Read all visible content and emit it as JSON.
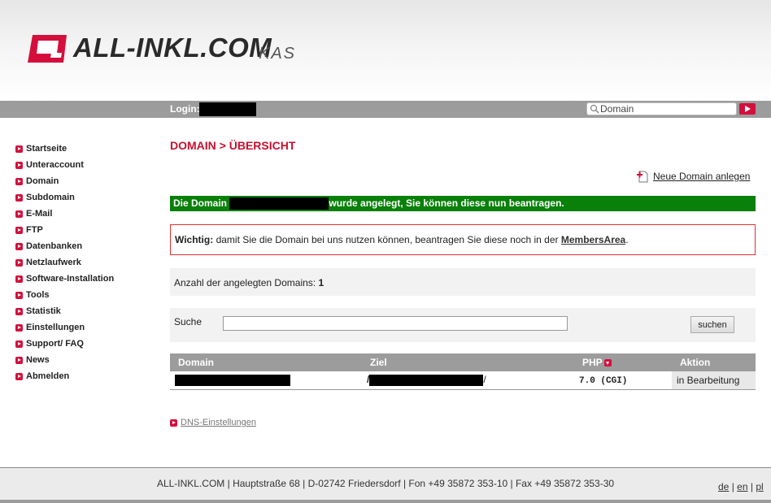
{
  "brand": {
    "name": "ALL-INKL.COM",
    "product": "KAS",
    "accent": "#d40f3c"
  },
  "loginbar": {
    "login_label": "Login:",
    "search_value": "Domain"
  },
  "sidebar": {
    "items": [
      {
        "label": "Startseite"
      },
      {
        "label": "Unteraccount"
      },
      {
        "label": "Domain"
      },
      {
        "label": "Subdomain"
      },
      {
        "label": "E-Mail"
      },
      {
        "label": "FTP"
      },
      {
        "label": "Datenbanken"
      },
      {
        "label": "Netzlaufwerk"
      },
      {
        "label": "Software-Installation"
      },
      {
        "label": "Tools"
      },
      {
        "label": "Statistik"
      },
      {
        "label": "Einstellungen"
      },
      {
        "label": "Support/ FAQ"
      },
      {
        "label": "News"
      },
      {
        "label": "Abmelden"
      }
    ]
  },
  "main": {
    "title": "DOMAIN > ÜBERSICHT",
    "new_domain_label": "Neue Domain anlegen",
    "success": {
      "prefix": "Die Domain",
      "suffix": "wurde angelegt, Sie können diese nun beantragen."
    },
    "warning": {
      "label": "Wichtig:",
      "text": "damit Sie die Domain bei uns nutzen können, beantragen Sie diese noch in der",
      "link": "MembersArea",
      "end": "."
    },
    "count": {
      "label": "Anzahl der angelegten Domains:",
      "value": "1"
    },
    "search": {
      "label": "Suche",
      "button": "suchen"
    },
    "table": {
      "headers": {
        "domain": "Domain",
        "ziel": "Ziel",
        "php": "PHP",
        "aktion": "Aktion"
      },
      "rows": [
        {
          "ziel_prefix": "/",
          "ziel_suffix": "/",
          "php": "7.0 (CGI)",
          "aktion": "in Bearbeitung"
        }
      ]
    },
    "dns_link": "DNS-Einstellungen"
  },
  "footer": {
    "address": "ALL-INKL.COM | Hauptstraße 68 | D-02742 Friedersdorf | Fon +49 35872 353-10 | Fax +49 35872 353-30",
    "lang": [
      "de",
      "en",
      "pl"
    ]
  },
  "colors": {
    "accent_red": "#d40f3c",
    "title_red": "#c8102e",
    "success_green": "#098009",
    "bar_gray": "#9c9c9c"
  }
}
